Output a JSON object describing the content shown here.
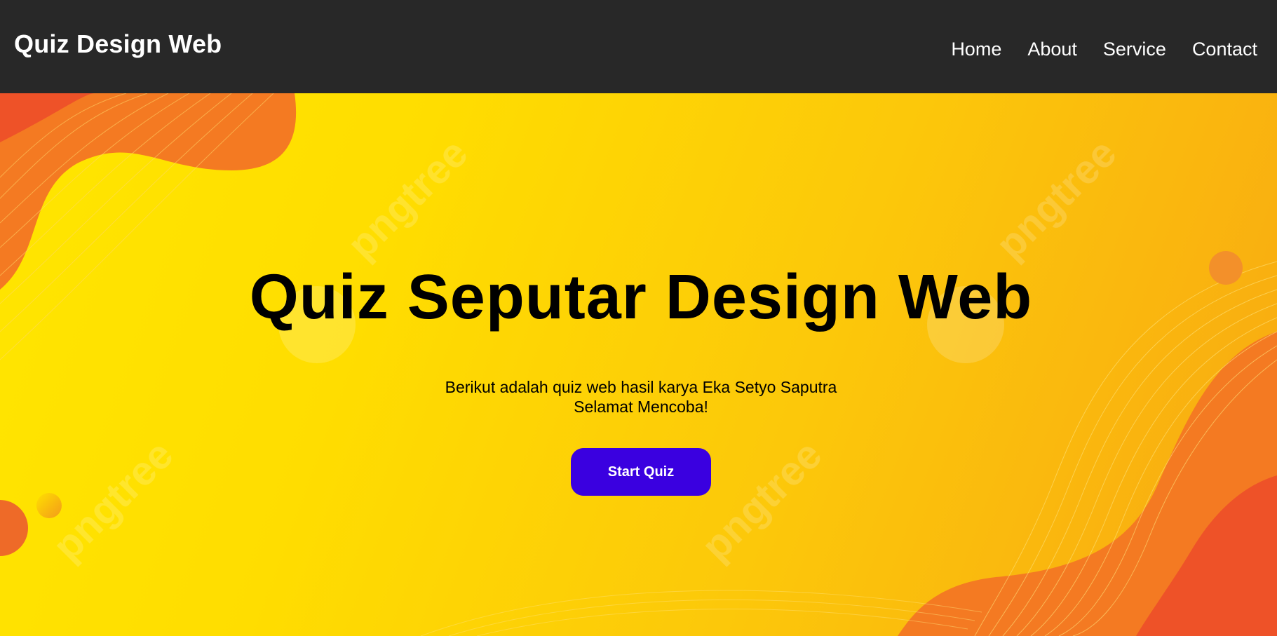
{
  "navbar": {
    "brand": "Quiz Design Web",
    "links": [
      {
        "label": "Home"
      },
      {
        "label": "About"
      },
      {
        "label": "Service"
      },
      {
        "label": "Contact"
      }
    ]
  },
  "hero": {
    "title": "Quiz Seputar Design Web",
    "description_line1": "Berikut adalah quiz web hasil karya Eka Setyo Saputra",
    "description_line2": "Selamat Mencoba!",
    "button_label": "Start Quiz",
    "watermark": "pngtree"
  },
  "colors": {
    "navbar_bg": "#282828",
    "hero_yellow": "#ffdd00",
    "hero_orange": "#f8a812",
    "wave_orange": "#f47a22",
    "wave_red": "#ee5228",
    "button_bg": "#3a00e0"
  }
}
